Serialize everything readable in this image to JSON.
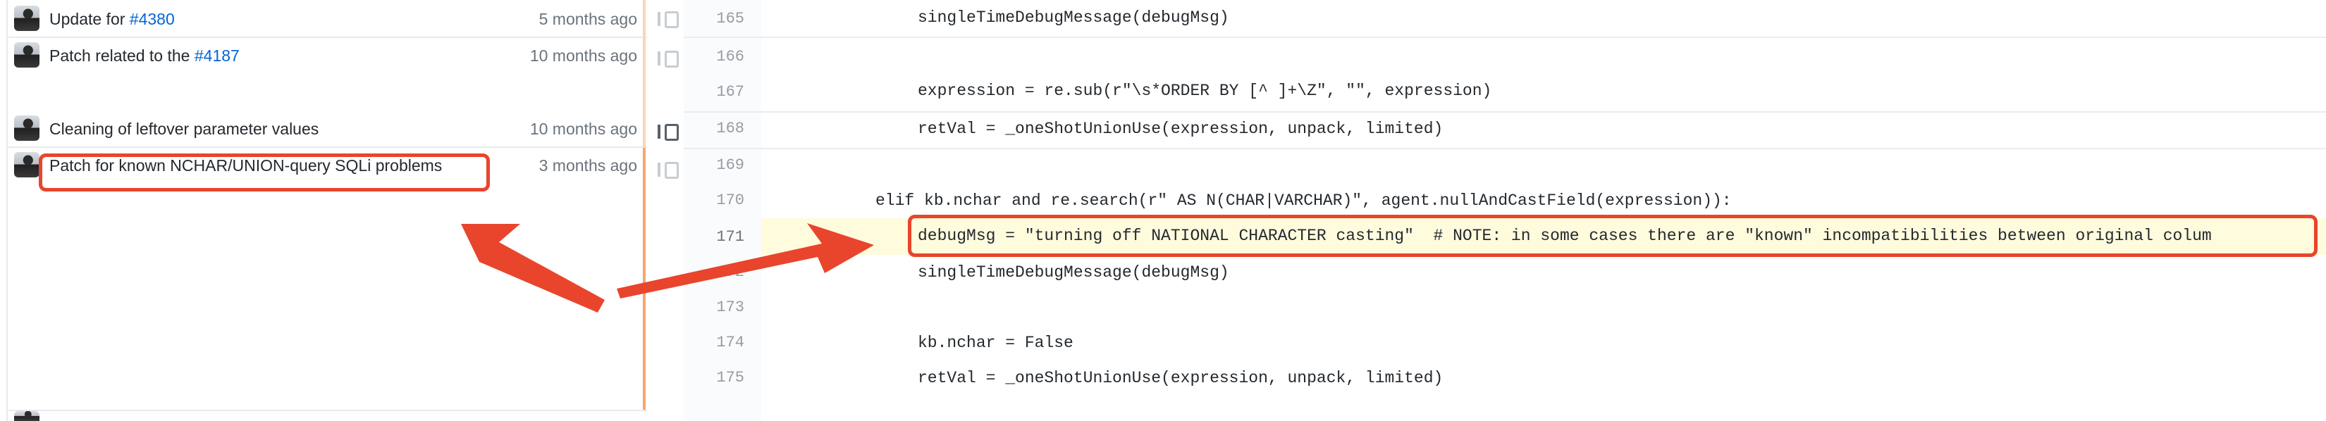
{
  "commits": [
    {
      "message_prefix": "Update for ",
      "issue": "#4380",
      "time": "5 months ago"
    },
    {
      "message_prefix": "Patch related to the ",
      "issue": "#4187",
      "time": "10 months ago"
    },
    {
      "message_prefix": "Cleaning of leftover parameter values",
      "issue": "",
      "time": "10 months ago"
    },
    {
      "message_prefix": "Patch for known NCHAR/UNION-query SQLi problems",
      "issue": "",
      "time": "3 months ago"
    }
  ],
  "lines": [
    {
      "num": "165",
      "code": "singleTimeDebugMessage(debugMsg)"
    },
    {
      "num": "166",
      "code": ""
    },
    {
      "num": "167",
      "code": "expression = re.sub(r\"\\s*ORDER BY [^ ]+\\Z\", \"\", expression)"
    },
    {
      "num": "168",
      "code": "retVal = _oneShotUnionUse(expression, unpack, limited)"
    },
    {
      "num": "169",
      "code": ""
    },
    {
      "num": "170",
      "code": "elif kb.nchar and re.search(r\" AS N(CHAR|VARCHAR)\", agent.nullAndCastField(expression)):"
    },
    {
      "num": "171",
      "code": "debugMsg = \"turning off NATIONAL CHARACTER casting\"  # NOTE: in some cases there are \"known\" incompatibilities between original colum"
    },
    {
      "num": "172",
      "code": "singleTimeDebugMessage(debugMsg)"
    },
    {
      "num": "173",
      "code": ""
    },
    {
      "num": "174",
      "code": "kb.nchar = False"
    },
    {
      "num": "175",
      "code": "retVal = _oneShotUnionUse(expression, unpack, limited)"
    }
  ],
  "colors": {
    "annotation": "#e8452c",
    "link": "#0366d6",
    "highlight": "#fffbdd"
  }
}
